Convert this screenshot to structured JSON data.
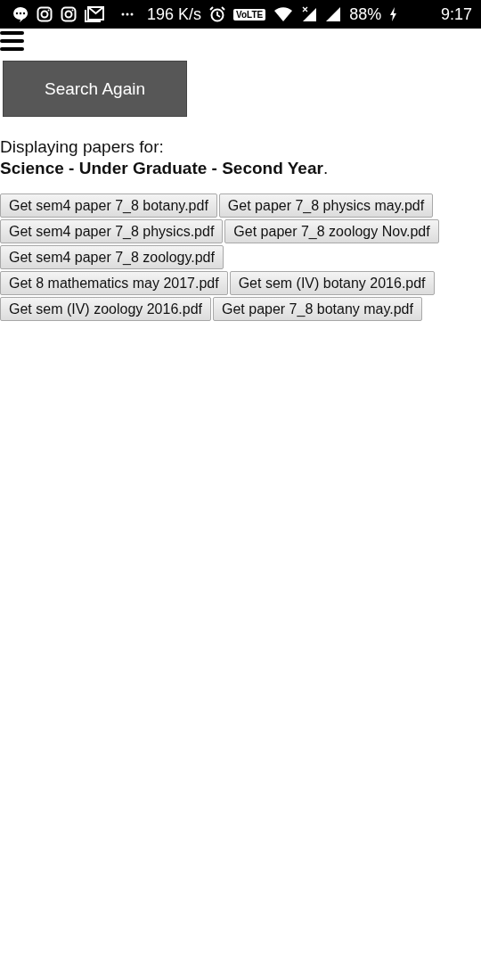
{
  "status_bar": {
    "network_speed": "196 K/s",
    "volte": "VoLTE",
    "battery": "88%",
    "time": "9:17"
  },
  "search_button": "Search Again",
  "intro": "Displaying papers for:",
  "selection": "**Science - Under Graduate - Second Year**.",
  "paper_rows": [
    [
      "Get sem4 paper 7_8 botany.pdf",
      "Get paper 7_8 physics may.pdf"
    ],
    [
      "Get sem4 paper 7_8 physics.pdf",
      "Get paper 7_8 zoology Nov.pdf"
    ],
    [
      "Get sem4 paper 7_8 zoology.pdf"
    ],
    [
      "Get 8 mathematics may 2017.pdf",
      "Get sem (IV) botany 2016.pdf"
    ],
    [
      "Get sem (IV) zoology 2016.pdf",
      "Get paper 7_8 botany may.pdf"
    ]
  ]
}
